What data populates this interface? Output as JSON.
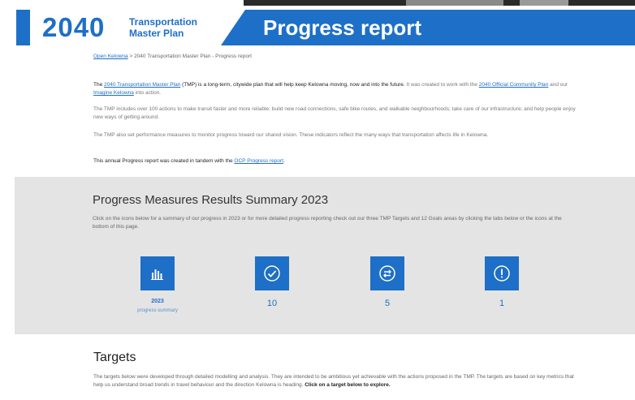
{
  "banner": {
    "year": "2040",
    "plan_line1": "Transportation",
    "plan_line2": "Master Plan",
    "title": "Progress report"
  },
  "breadcrumb": {
    "home": "Open Kelowna",
    "sep": ">",
    "current": "2040 Transportation Master Plan - Progress report"
  },
  "intro": {
    "p1_pre": "The ",
    "p1_link1": "2040 Transportation Master Plan",
    "p1_mid": " (TMP) is a long-term, citywide plan that will help keep Kelowna moving, now and into the future.",
    "p1_rest": " It was created to work with the ",
    "p1_link2": "2040 Official Community Plan",
    "p1_and": " and our ",
    "p1_link3": "Imagine Kelowna",
    "p1_end": " into action.",
    "p2": "The TMP includes over 100 actions to make transit faster and more reliable; build new road connections, safe bike routes, and walkable neighbourhoods; take care of our infrastructure; and help people enjoy new ways of getting around.",
    "p3": "The TMP also set performance measures to monitor progress toward our shared vision. These indicators reflect the many ways that transportation affects life in Kelowna.",
    "p4_pre": "This annual Progress report was created in tandem with the ",
    "p4_link": "OCP Progress report",
    "p4_end": "."
  },
  "summary": {
    "heading": "Progress Measures Results Summary 2023",
    "description": "Click on the icons below for a summary of our progress in 2023 or for more detailed progress reporting check out our three TMP Targets and 12 Goals areas by clicking the tabs below or the icons at the bottom of this page.",
    "tiles": [
      {
        "icon": "bar-chart-icon",
        "value": "2023",
        "sub": "progress summary"
      },
      {
        "icon": "check-circle-icon",
        "value": "10",
        "sub": ""
      },
      {
        "icon": "swap-arrows-icon",
        "value": "5",
        "sub": ""
      },
      {
        "icon": "exclamation-circle-icon",
        "value": "1",
        "sub": ""
      }
    ]
  },
  "targets": {
    "heading": "Targets",
    "text": "The targets below were developed through detailed modelling and analysis. They are intended to be ambitious yet achievable with the actions proposed in the TMP. The targets are based on key metrics that help us understand broad trends in travel behaviour and the direction Kelowna is heading.",
    "cta": "Click on a target below to explore."
  },
  "colors": {
    "brand_blue": "#1e6fc7",
    "section_grey": "#e4e4e4"
  }
}
